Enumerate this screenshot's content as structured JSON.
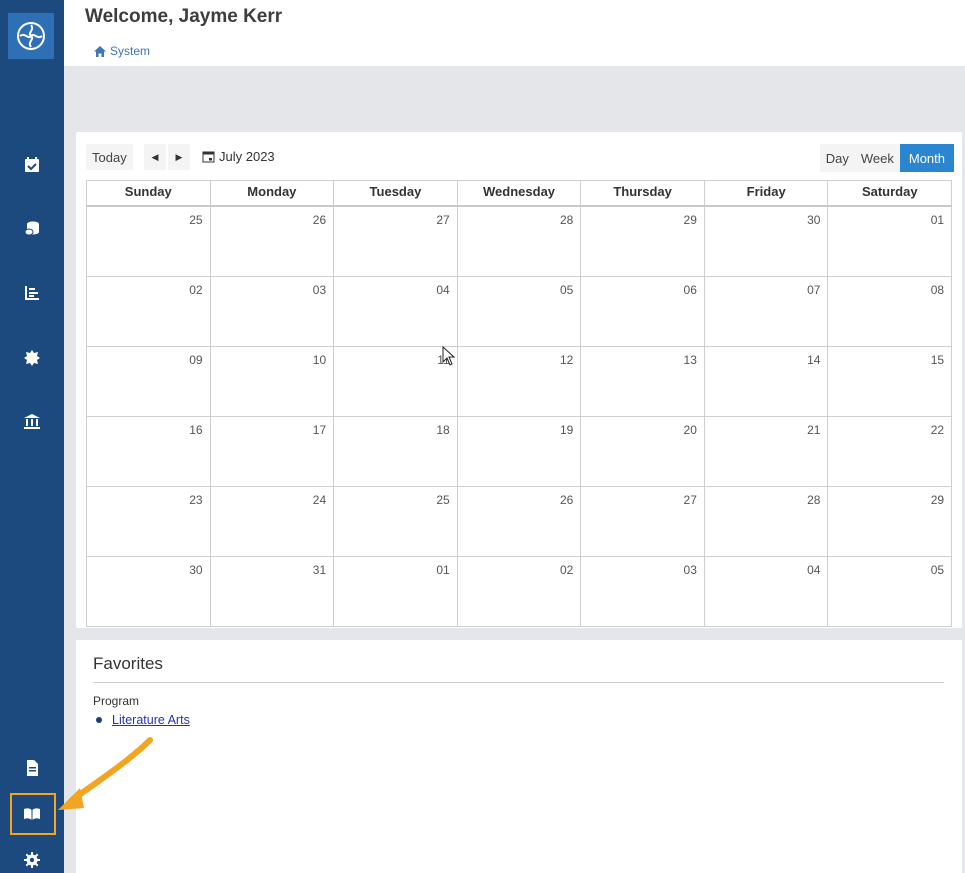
{
  "header": {
    "welcome": "Welcome, Jayme Kerr",
    "breadcrumb": "System"
  },
  "sidebar": {
    "items": [
      {
        "icon": "calendar-check-icon"
      },
      {
        "icon": "coins-icon"
      },
      {
        "icon": "bar-chart-icon"
      },
      {
        "icon": "badge-icon"
      },
      {
        "icon": "institution-icon"
      },
      {
        "icon": "document-icon"
      },
      {
        "icon": "book-open-icon"
      },
      {
        "icon": "gear-icon"
      }
    ]
  },
  "calendar": {
    "today_label": "Today",
    "prev_label": "◀",
    "next_label": "▶",
    "month_title": "July 2023",
    "views": [
      "Day",
      "Week",
      "Month"
    ],
    "active_view": "Month",
    "weekdays": [
      "Sunday",
      "Monday",
      "Tuesday",
      "Wednesday",
      "Thursday",
      "Friday",
      "Saturday"
    ],
    "weeks": [
      [
        "25",
        "26",
        "27",
        "28",
        "29",
        "30",
        "01"
      ],
      [
        "02",
        "03",
        "04",
        "05",
        "06",
        "07",
        "08"
      ],
      [
        "09",
        "10",
        "11",
        "12",
        "13",
        "14",
        "15"
      ],
      [
        "16",
        "17",
        "18",
        "19",
        "20",
        "21",
        "22"
      ],
      [
        "23",
        "24",
        "25",
        "26",
        "27",
        "28",
        "29"
      ],
      [
        "30",
        "31",
        "01",
        "02",
        "03",
        "04",
        "05"
      ]
    ]
  },
  "favorites": {
    "title": "Favorites",
    "group_label": "Program",
    "items": [
      "Literature Arts"
    ]
  },
  "colors": {
    "sidebar": "#1c4a7e",
    "accent": "#2a86d1",
    "highlight": "#f3a521",
    "link": "#2631b8"
  }
}
